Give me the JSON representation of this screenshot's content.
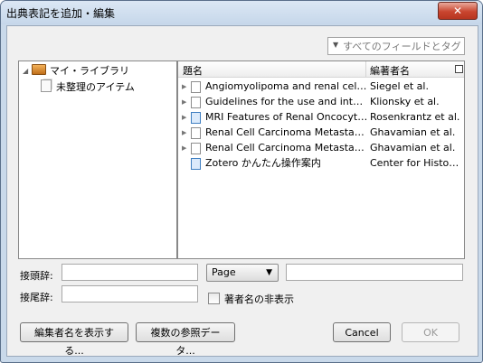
{
  "window": {
    "title": "出典表記を追加・編集",
    "close_glyph": "✕"
  },
  "search": {
    "placeholder": "すべてのフィールドとタグ",
    "dropdown_glyph": "▼"
  },
  "tree": {
    "items": [
      {
        "label": "マイ・ライブラリ",
        "icon": "library-icon",
        "expanded": true
      },
      {
        "label": "未整理のアイテム",
        "icon": "unfiled-items-icon"
      }
    ]
  },
  "items": {
    "columns": {
      "title": "題名",
      "creator": "編著者名"
    },
    "rows": [
      {
        "title": "Angiomyolipoma and renal cell …",
        "creator": "Siegel et al.",
        "type": "document"
      },
      {
        "title": "Guidelines for the use and inter…",
        "creator": "Klionsky et al.",
        "type": "document"
      },
      {
        "title": "MRI Features of Renal Oncocyt…",
        "creator": "Rosenkrantz et al.",
        "type": "webpage"
      },
      {
        "title": "Renal Cell Carcinoma Metastati…",
        "creator": "Ghavamian et al.",
        "type": "document"
      },
      {
        "title": "Renal Cell Carcinoma Metastati…",
        "creator": "Ghavamian et al.",
        "type": "document"
      },
      {
        "title": "Zotero かんたん操作案内",
        "creator": "Center for History…",
        "type": "webpage"
      }
    ]
  },
  "form": {
    "prefix_label": "接頭辞:",
    "prefix_value": "",
    "suffix_label": "接尾辞:",
    "suffix_value": "",
    "locator_type": "Page",
    "locator_value": "",
    "suppress_author_label": "著者名の非表示",
    "suppress_author_checked": false
  },
  "buttons": {
    "show_editor": "編集者名を表示する...",
    "multiple_sources": "複数の参照データ...",
    "cancel": "Cancel",
    "ok": "OK"
  }
}
